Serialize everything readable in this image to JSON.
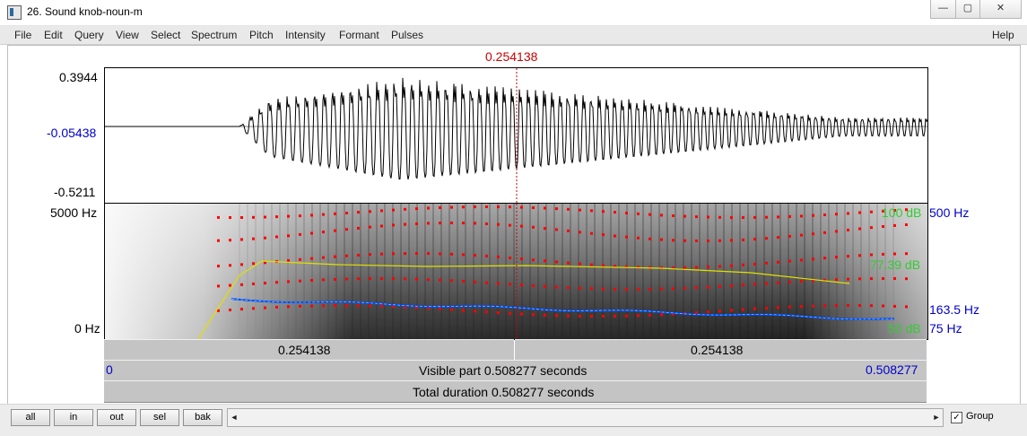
{
  "window": {
    "title": "26. Sound knob-noun-m",
    "min_glyph": "—",
    "max_glyph": "▢",
    "close_glyph": "✕"
  },
  "menu": {
    "items": [
      "File",
      "Edit",
      "Query",
      "View",
      "Select",
      "Spectrum",
      "Pitch",
      "Intensity",
      "Formant",
      "Pulses"
    ],
    "help": "Help"
  },
  "cursor": {
    "time_label": "0.254138"
  },
  "waveform": {
    "y_max": "0.3944",
    "y_mid": "-0.05438",
    "y_min": "-0.5211"
  },
  "spectrogram": {
    "freq_top": "5000 Hz",
    "freq_bottom": "0 Hz",
    "intensity_top": "100 dB",
    "intensity_mid": "77.39 dB",
    "intensity_bottom": "50 dB",
    "pitch_top": "500 Hz",
    "pitch_current": "163.5 Hz",
    "pitch_bottom": "75 Hz"
  },
  "bars": {
    "left_part": "0.254138",
    "right_part": "0.254138",
    "visible_start": "0",
    "visible_label": "Visible part 0.508277 seconds",
    "visible_end": "0.508277",
    "total_label": "Total duration 0.508277 seconds"
  },
  "toolbar": {
    "buttons": [
      "all",
      "in",
      "out",
      "sel",
      "bak"
    ],
    "scroll_left": "◄",
    "scroll_right": "►",
    "group_label": "Group",
    "group_checked": true,
    "check_glyph": "✓"
  },
  "colors": {
    "cursor": "#cc0000",
    "blue_label": "#0000cc",
    "intensity": "#33cc33",
    "pitch_line": "#0044ff",
    "formant_dots": "#ff0000",
    "intensity_curve": "#dddd00"
  }
}
